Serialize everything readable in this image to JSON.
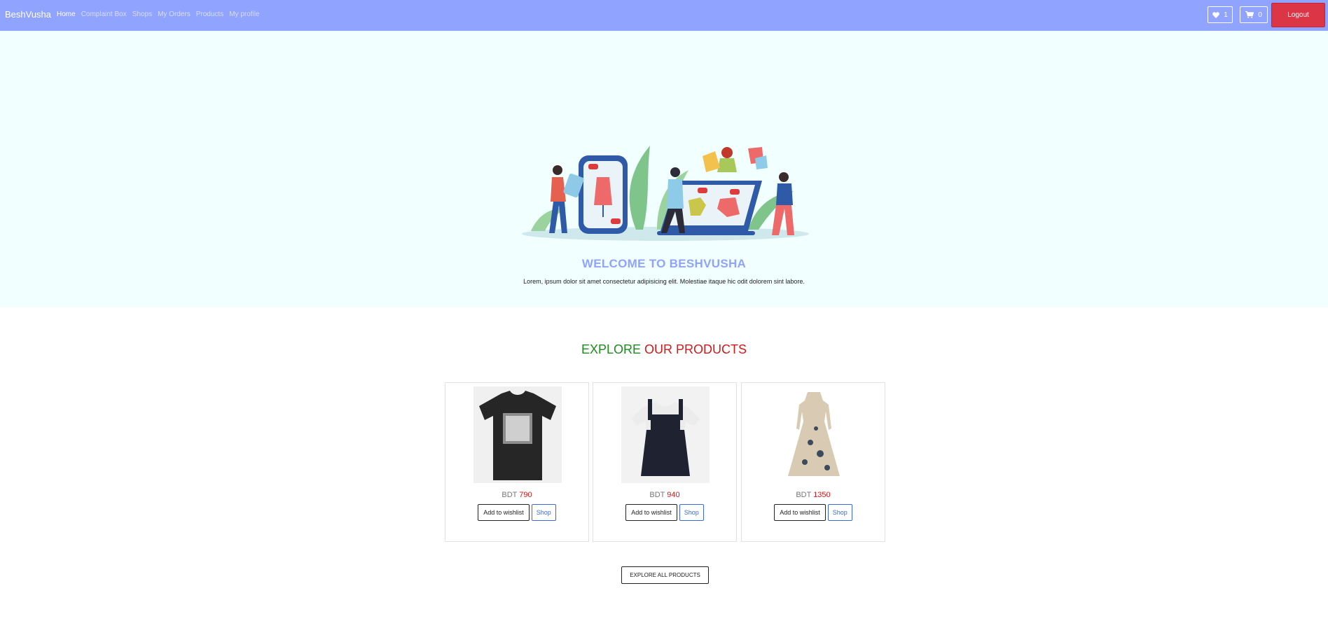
{
  "navbar": {
    "brand": "BeshVusha",
    "links": [
      {
        "label": "Home",
        "active": true
      },
      {
        "label": "Complaint Box",
        "active": false
      },
      {
        "label": "Shops",
        "active": false
      },
      {
        "label": "My Orders",
        "active": false
      },
      {
        "label": "Products",
        "active": false
      },
      {
        "label": "My profile",
        "active": false
      }
    ],
    "wishlist_count": "1",
    "cart_count": "0",
    "logout_label": "Logout",
    "icons": {
      "wishlist": "heart-icon",
      "cart": "cart-icon"
    },
    "colors": {
      "background": "#8fa3ff",
      "logout": "#dc3545"
    }
  },
  "hero": {
    "title": "WELCOME TO BESHVUSHA",
    "subtitle": "Lorem, ipsum dolor sit amet consectetur adipisicing elit. Molestiae itaque hic odit dolorem sint labore.",
    "colors": {
      "background": "#f1fffe",
      "title": "#8fa3ff"
    }
  },
  "products_section": {
    "title_part1": "EXPLORE",
    "title_part2": "OUR PRODUCTS",
    "colors": {
      "part1": "#1e8a1e",
      "part2": "#d11a1a"
    },
    "products": [
      {
        "currency": "BDT",
        "price": "790",
        "wishlist_label": "Add to wishlist",
        "shop_label": "Shop"
      },
      {
        "currency": "BDT",
        "price": "940",
        "wishlist_label": "Add to wishlist",
        "shop_label": "Shop"
      },
      {
        "currency": "BDT",
        "price": "1350",
        "wishlist_label": "Add to wishlist",
        "shop_label": "Shop"
      }
    ],
    "explore_all_label": "EXPLORE ALL PRODUCTS"
  }
}
